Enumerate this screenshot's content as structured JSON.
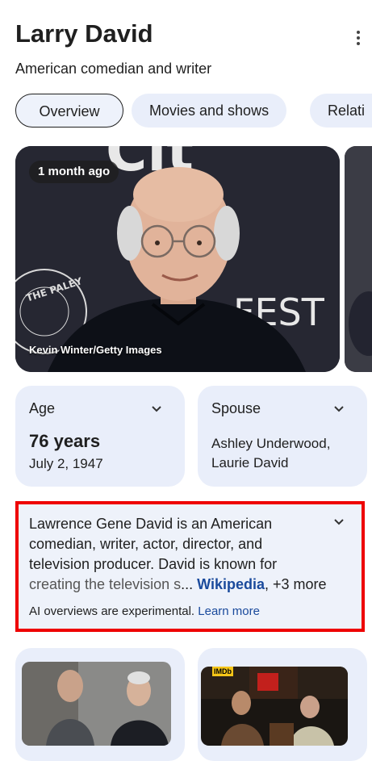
{
  "header": {
    "title": "Larry David",
    "subtitle": "American comedian and writer"
  },
  "tabs": [
    {
      "label": "Overview"
    },
    {
      "label": "Movies and shows"
    },
    {
      "label": "Relati"
    }
  ],
  "photo": {
    "age_badge": "1 month ago",
    "credit": "Kevin Winter/Getty Images",
    "backdrop_text": "FEST",
    "seal_text": "THE PALEY CENTER FOR MEDIA"
  },
  "facts": {
    "age": {
      "label": "Age",
      "value": "76 years",
      "detail": "July 2, 1947"
    },
    "spouse": {
      "label": "Spouse",
      "value_line1": "Ashley Underwood,",
      "value_line2": "Laurie David"
    }
  },
  "ai_overview": {
    "text_lines": [
      "Lawrence Gene David is an American",
      "comedian, writer, actor, director, and",
      "television producer. David is known for"
    ],
    "last_line_text": "creating the television s",
    "ellipsis": "...",
    "source": "Wikipedia",
    "more": ", +3 more",
    "note": "AI overviews are experimental.",
    "learn_more": "Learn more"
  },
  "media_badge": "IMDb",
  "colors": {
    "accent_link": "#1a4a9c",
    "card_bg": "#e9eefa",
    "highlight_border": "#ee0000"
  }
}
